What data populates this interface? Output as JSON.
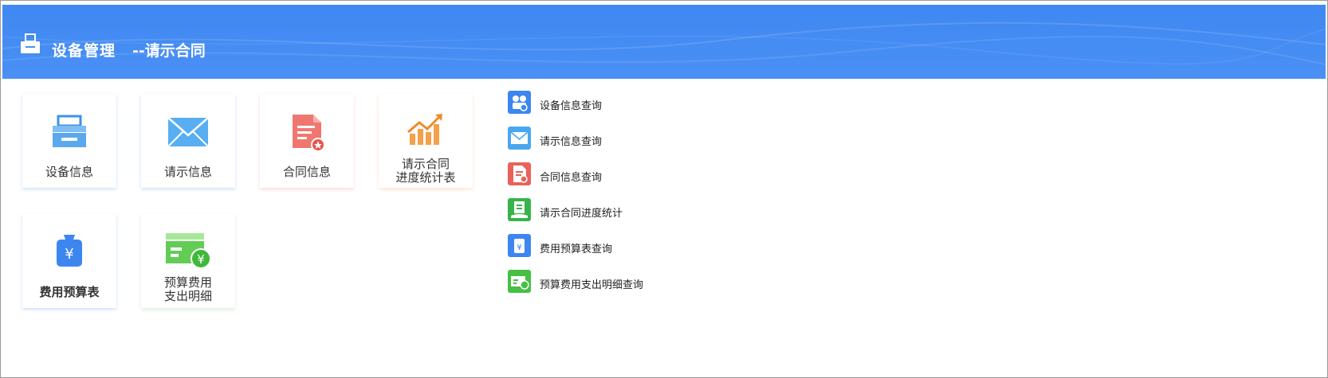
{
  "header": {
    "title": "设备管理",
    "subtitle": "--请示合同",
    "icon": "printer-icon",
    "bg_color": "#4a90f4"
  },
  "tiles": [
    {
      "label": "设备信息",
      "icon": "printer-icon"
    },
    {
      "label": "请示信息",
      "icon": "envelope-icon"
    },
    {
      "label": "合同信息",
      "icon": "contract-icon"
    },
    {
      "label_line1": "请示合同",
      "label_line2": "进度统计表",
      "icon": "growth-chart-icon"
    },
    {
      "label": "费用预算表",
      "icon": "money-bag-icon"
    },
    {
      "label_line1": "预算费用",
      "label_line2": "支出明细",
      "icon": "yuan-card-icon"
    }
  ],
  "quick_links": [
    {
      "label": "设备信息查询",
      "icon": "equipment-info-icon",
      "color": "#3d86ef"
    },
    {
      "label": "请示信息查询",
      "icon": "envelope-icon",
      "color": "#4aa7ef"
    },
    {
      "label": "合同信息查询",
      "icon": "contract-icon",
      "color": "#e8625b"
    },
    {
      "label": "请示合同进度统计",
      "icon": "progress-stat-icon",
      "color": "#36b34a"
    },
    {
      "label": "费用预算表查询",
      "icon": "money-bag-icon",
      "color": "#3d86ef"
    },
    {
      "label": "预算费用支出明细查询",
      "icon": "yuan-card-icon",
      "color": "#45c045"
    }
  ]
}
